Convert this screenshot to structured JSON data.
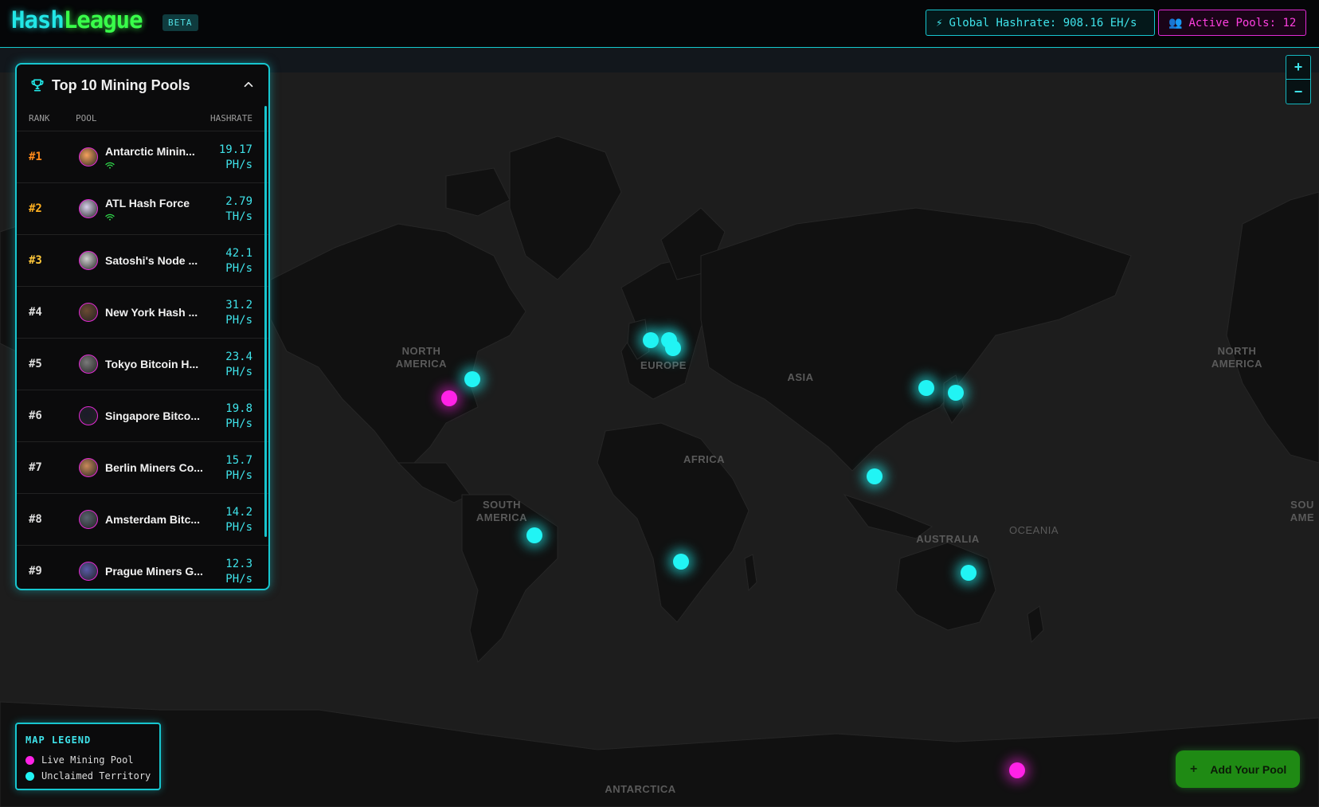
{
  "app": {
    "logo_part1": "Hash",
    "logo_part2": "League",
    "badge": "BETA"
  },
  "stats": {
    "hashrate_icon": "⚡",
    "hashrate_label": "Global Hashrate: 908.16 EH/s",
    "pools_icon": "👥",
    "pools_label": "Active Pools: 12"
  },
  "zoom": {
    "in": "+",
    "out": "−"
  },
  "panel": {
    "title": "Top 10 Mining Pools",
    "columns": {
      "rank": "RANK",
      "pool": "POOL",
      "hashrate": "HASHRATE"
    },
    "pools": [
      {
        "rank": "#1",
        "name": "Antarctic Minin...",
        "rate": "19.17",
        "unit": "PH/s",
        "live": true
      },
      {
        "rank": "#2",
        "name": "ATL Hash Force",
        "rate": "2.79",
        "unit": "TH/s",
        "live": true
      },
      {
        "rank": "#3",
        "name": "Satoshi's Node ...",
        "rate": "42.1",
        "unit": "PH/s",
        "live": false
      },
      {
        "rank": "#4",
        "name": "New York Hash ...",
        "rate": "31.2",
        "unit": "PH/s",
        "live": false
      },
      {
        "rank": "#5",
        "name": "Tokyo Bitcoin H...",
        "rate": "23.4",
        "unit": "PH/s",
        "live": false
      },
      {
        "rank": "#6",
        "name": "Singapore Bitco...",
        "rate": "19.8",
        "unit": "PH/s",
        "live": false
      },
      {
        "rank": "#7",
        "name": "Berlin Miners Co...",
        "rate": "15.7",
        "unit": "PH/s",
        "live": false
      },
      {
        "rank": "#8",
        "name": "Amsterdam Bitc...",
        "rate": "14.2",
        "unit": "PH/s",
        "live": false
      },
      {
        "rank": "#9",
        "name": "Prague Miners G...",
        "rate": "12.3",
        "unit": "PH/s",
        "live": false
      }
    ]
  },
  "map": {
    "regions": {
      "north_america": "NORTH AMERICA",
      "north_america_2": "NORTH AMERICA",
      "europe": "EUROPE",
      "asia": "ASIA",
      "africa": "AFRICA",
      "south_america": "SOUTH AMERICA",
      "south_america_2": "SOU AME",
      "australia": "AUSTRALIA",
      "oceania": "OCEANIA",
      "antarctica": "ANTARCTICA"
    }
  },
  "legend": {
    "title": "MAP LEGEND",
    "live": "Live Mining Pool",
    "unclaimed": "Unclaimed Territory",
    "live_color": "#ff22e6",
    "unclaimed_color": "#21f4f4"
  },
  "add_button": {
    "label": "Add Your Pool",
    "icon": "+"
  }
}
